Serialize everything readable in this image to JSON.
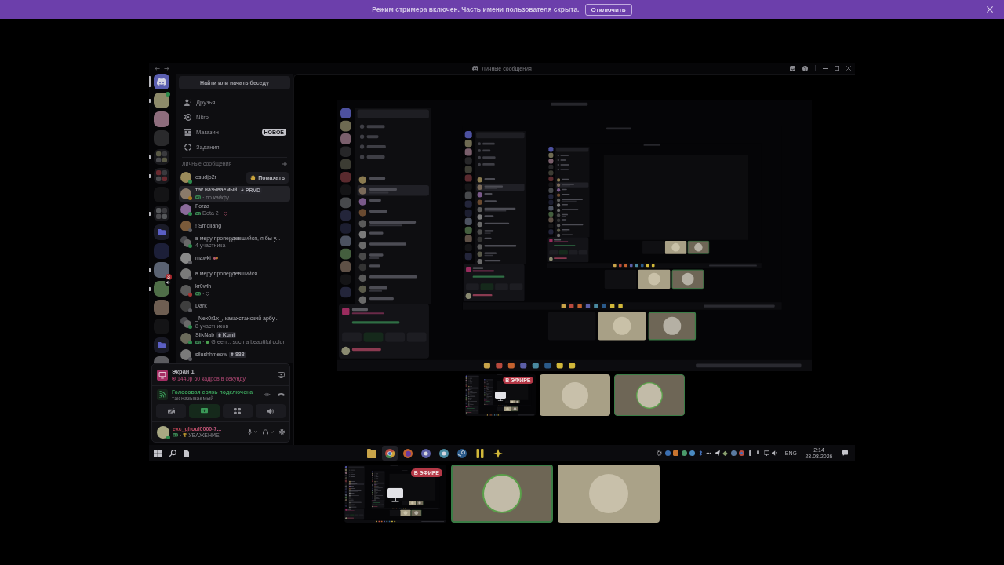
{
  "banner": {
    "text": "Режим стримера включен. Часть имени пользователя скрыта.",
    "button": "Отключить"
  },
  "screen": {
    "window": {
      "title": "Личные сообщения"
    },
    "servers": [
      {
        "kind": "home",
        "selected": true,
        "unread": false,
        "voice": false
      },
      {
        "kind": "server",
        "selected": false,
        "unread": true,
        "voice": false,
        "color": "#2e8b4d"
      },
      {
        "kind": "server",
        "selected": false,
        "unread": false,
        "voice": false
      },
      {
        "kind": "server",
        "selected": false,
        "unread": false,
        "voice": false
      },
      {
        "kind": "folder_group",
        "selected": false,
        "unread": true,
        "voice": false
      },
      {
        "kind": "folder_group",
        "selected": false,
        "unread": true,
        "voice": false
      },
      {
        "kind": "server",
        "selected": false,
        "unread": false,
        "voice": false
      },
      {
        "kind": "folder_group",
        "selected": false,
        "unread": true,
        "voice": false
      },
      {
        "kind": "folder",
        "selected": false,
        "unread": false,
        "voice": false
      },
      {
        "kind": "server",
        "selected": false,
        "unread": false,
        "voice": false
      },
      {
        "kind": "server",
        "selected": false,
        "unread": true,
        "voice": false,
        "badge": "3"
      },
      {
        "kind": "server",
        "selected": false,
        "unread": true,
        "voice": true
      },
      {
        "kind": "server",
        "selected": false,
        "unread": false,
        "voice": false
      },
      {
        "kind": "server",
        "selected": false,
        "unread": false,
        "voice": false
      },
      {
        "kind": "folder",
        "selected": false,
        "unread": false,
        "voice": false
      },
      {
        "kind": "server",
        "selected": false,
        "unread": false,
        "voice": false
      }
    ],
    "search": {
      "label": "Найти или начать беседу"
    },
    "nav": [
      {
        "kind": "friends",
        "label": "Друзья"
      },
      {
        "kind": "nitro",
        "label": "Nitro"
      },
      {
        "kind": "shop",
        "label": "Магазин",
        "badge": "НОВОЕ"
      },
      {
        "kind": "quests",
        "label": "Задания"
      }
    ],
    "dm_header": "Личные сообщения",
    "dms": [
      {
        "kind": "user",
        "name": "osudjo2r",
        "color": "#2e8b4d",
        "selected": false,
        "action": "Помахать"
      },
      {
        "kind": "user",
        "name": "так называемый",
        "color": "#a9791f",
        "selected": true,
        "tag": "PRVD",
        "subtitle": {
          "text": "· по кайфу"
        }
      },
      {
        "kind": "user",
        "name": "Forza",
        "color": "#2e8b4d",
        "selected": false,
        "subtitle": {
          "text": "Dota 2 ·"
        }
      },
      {
        "kind": "user",
        "name": "! Smoilang",
        "color": "#5c5c62",
        "selected": false
      },
      {
        "kind": "group",
        "name": "в меру пропердевшийся, я бы у...",
        "color": "#2e8b4d",
        "selected": false,
        "subtitle": {
          "text": "4 участника"
        }
      },
      {
        "kind": "user",
        "name": "mawki",
        "color": "#5c5c62",
        "selected": false
      },
      {
        "kind": "user",
        "name": "в меру пропердевшийся",
        "color": "#5c5c62",
        "selected": false
      },
      {
        "kind": "user",
        "name": "kr0wlh",
        "color": "#a33434",
        "selected": false,
        "subtitle": {
          "text": "·"
        }
      },
      {
        "kind": "user",
        "name": "Dark",
        "color": "#5c5c62",
        "selected": false
      },
      {
        "kind": "group",
        "name": "_Nex0r1x_, казахстанский арбу...",
        "color": "#2e8b4d",
        "selected": false,
        "subtitle": {
          "text": "8 участников"
        }
      },
      {
        "kind": "user",
        "name": "SlikNab",
        "color": "#2e8b4d",
        "selected": false,
        "tag": "Kuni",
        "subtitle": {
          "lead": "·",
          "text": "Green... such a beautiful color"
        }
      },
      {
        "kind": "user",
        "name": "silushhmeow",
        "color": "#5c5c62",
        "selected": false,
        "tag": "888"
      }
    ],
    "stream": {
      "title": "Экран 1",
      "quality": "1440p 60 кадров в секунду"
    },
    "voice": {
      "status": "Голосовая связь подключена",
      "channel": "так называемый"
    },
    "voice_buttons": [
      {
        "kind": "camera",
        "active": false
      },
      {
        "kind": "screen",
        "active": true
      },
      {
        "kind": "activities",
        "active": false
      },
      {
        "kind": "soundboard",
        "active": false
      }
    ],
    "user": {
      "name": "exc_ghoul0000-7...",
      "color": "#2e8b4d",
      "subtitle": {
        "lead": "·",
        "text": "УВАЖЕНИЕ"
      }
    },
    "stage_tiles": [
      {
        "kind": "stream",
        "badge": "В ЭФИРЕ",
        "speaking": false
      },
      {
        "kind": "user",
        "color": "#a8a086",
        "speaking": false
      },
      {
        "kind": "user",
        "color": "#6e6656",
        "speaking": true
      }
    ],
    "taskbar": {
      "apps": [
        {
          "kind": "folder",
          "active": false
        },
        {
          "kind": "chrome",
          "active": true
        },
        {
          "kind": "firefox",
          "active": false
        },
        {
          "kind": "app",
          "color": "#5c5fa8",
          "active": false
        },
        {
          "kind": "app",
          "color": "#4a8aa0",
          "active": false
        },
        {
          "kind": "steam",
          "active": false
        },
        {
          "kind": "bars",
          "active": false
        },
        {
          "kind": "star",
          "active": false
        }
      ],
      "language": "ENG",
      "time": "2:14",
      "date": "23.08.2026"
    }
  },
  "tiles": [
    {
      "kind": "stream",
      "badge": "В ЭФИРЕ",
      "speaking": false
    },
    {
      "kind": "user",
      "color": "#6e6655",
      "speaking": true
    },
    {
      "kind": "user",
      "color": "#aaa288",
      "speaking": false
    }
  ]
}
